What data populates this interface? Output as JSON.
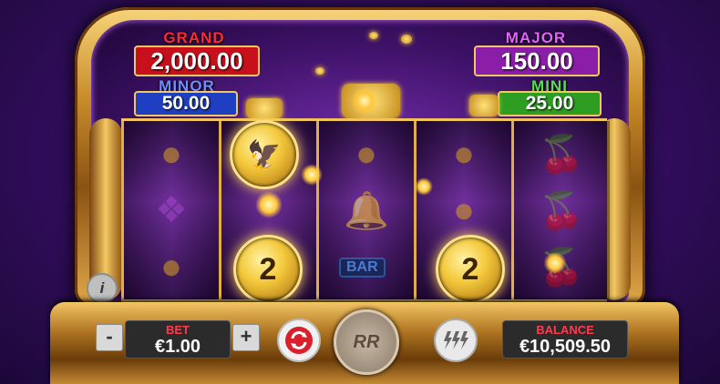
{
  "jackpots": {
    "grand": {
      "label": "GRAND",
      "value": "2,000.00",
      "color": "#d8141f"
    },
    "major": {
      "label": "MAJOR",
      "value": "150.00",
      "color": "#8b1ea8"
    },
    "minor": {
      "label": "MINOR",
      "value": "50.00",
      "color": "#1f3fc2"
    },
    "mini": {
      "label": "MINI",
      "value": "25.00",
      "color": "#2e9e23"
    }
  },
  "reels": {
    "coin_values": [
      "2",
      "2"
    ],
    "bar_label": "BAR",
    "symbols": [
      "lemon-icon",
      "grape-icon",
      "bell-icon",
      "cherry-icon",
      "bar-icon",
      "eagle-coin-icon"
    ]
  },
  "controls": {
    "bet_label": "BET",
    "bet_value": "€1.00",
    "minus": "-",
    "plus": "+",
    "balance_label": "BALANCE",
    "balance_value": "€10,509.50",
    "spin_label": "RR",
    "info": "i"
  },
  "colors": {
    "gold": "#f3c761",
    "label_red": "#ff3b4d",
    "background_purple": "#3a0f6b"
  }
}
